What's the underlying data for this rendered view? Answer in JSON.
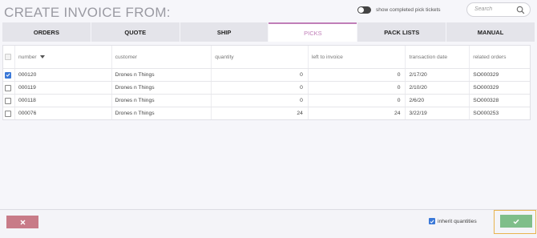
{
  "header": {
    "title": "CREATE INVOICE FROM:",
    "toggle_label": "show completed pick tickets",
    "toggle_on": false,
    "search_placeholder": "Search"
  },
  "tabs": [
    {
      "label": "ORDERS",
      "active": false
    },
    {
      "label": "QUOTE",
      "active": false
    },
    {
      "label": "SHIP",
      "active": false
    },
    {
      "label": "PICKS",
      "active": true
    },
    {
      "label": "PACK LISTS",
      "active": false
    },
    {
      "label": "MANUAL",
      "active": false
    }
  ],
  "table": {
    "columns": [
      "number",
      "customer",
      "quantity",
      "left to invoice",
      "transaction date",
      "related orders"
    ],
    "rows": [
      {
        "checked": true,
        "number": "000120",
        "customer": "Drones n Things",
        "quantity": "0",
        "left_to_invoice": "0",
        "transaction_date": "2/17/20",
        "related_orders": "SO000329"
      },
      {
        "checked": false,
        "number": "000119",
        "customer": "Drones n Things",
        "quantity": "0",
        "left_to_invoice": "0",
        "transaction_date": "2/10/20",
        "related_orders": "SO000329"
      },
      {
        "checked": false,
        "number": "000118",
        "customer": "Drones n Things",
        "quantity": "0",
        "left_to_invoice": "0",
        "transaction_date": "2/6/20",
        "related_orders": "SO000328"
      },
      {
        "checked": false,
        "number": "000076",
        "customer": "Drones n Things",
        "quantity": "24",
        "left_to_invoice": "24",
        "transaction_date": "3/22/19",
        "related_orders": "SO000253"
      }
    ]
  },
  "footer": {
    "inherit_label": "inherit quantities",
    "inherit_checked": true
  },
  "colors": {
    "accent_active_tab": "#c07eb8",
    "cancel": "#c87b88",
    "confirm": "#7fbe8a",
    "focus": "#e8b450",
    "checkbox": "#3a78d8"
  }
}
